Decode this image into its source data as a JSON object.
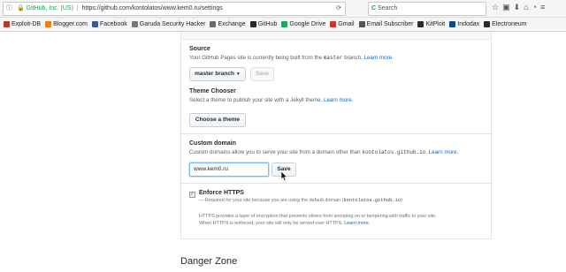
{
  "browser": {
    "identity": "GitHub, Inc. (US)",
    "url": "https://github.com/kontolatos/www.kem0.ru/settings",
    "search_placeholder": "Search",
    "bookmarks": [
      {
        "label": "Exploit-DB",
        "color": "#b03a2e"
      },
      {
        "label": "Blogger.com",
        "color": "#f57d00"
      },
      {
        "label": "Facebook",
        "color": "#3b5998"
      },
      {
        "label": "Garuda Security Hacker",
        "color": "#777777"
      },
      {
        "label": "Exchange",
        "color": "#6b6b6b"
      },
      {
        "label": "GitHub",
        "color": "#24292e"
      },
      {
        "label": "Google Drive",
        "color": "#1fa463"
      },
      {
        "label": "Gmail",
        "color": "#d93025"
      },
      {
        "label": "Email Subscriber",
        "color": "#555555"
      },
      {
        "label": "KitPloit",
        "color": "#2d2d2d"
      },
      {
        "label": "Indodax",
        "color": "#0b4d8c"
      },
      {
        "label": "Electroneum",
        "color": "#2a2a2a"
      }
    ]
  },
  "source": {
    "title": "Source",
    "description_before": "Your GitHub Pages site is currently being built from the ",
    "description_code": "master",
    "description_after": " branch. ",
    "learn_more": "Learn more.",
    "branch_button": "master branch",
    "save_button": "Save"
  },
  "theme": {
    "title": "Theme Chooser",
    "description": "Select a theme to publish your site with a Jekyll theme. ",
    "learn_more": "Learn more.",
    "button": "Choose a theme"
  },
  "custom_domain": {
    "title": "Custom domain",
    "description_before": "Custom domains allow you to serve your site from a domain other than ",
    "description_code": "kontolatos.github.io",
    "description_after": ". ",
    "learn_more": "Learn more.",
    "input_value": "www.kem0.ru",
    "save_button": "Save"
  },
  "https": {
    "title": "Enforce HTTPS",
    "required_before": "— Required for your site because you are using the default domain (",
    "required_code": "kontolatos.github.io",
    "required_after": ")",
    "info_line1": "HTTPS provides a layer of encryption that prevents others from snooping on or tampering with traffic to your site.",
    "info_line2": "When HTTPS is enforced, your site will only be served over HTTPS. ",
    "learn_more": "Learn more."
  },
  "danger_zone": {
    "title": "Danger Zone"
  }
}
